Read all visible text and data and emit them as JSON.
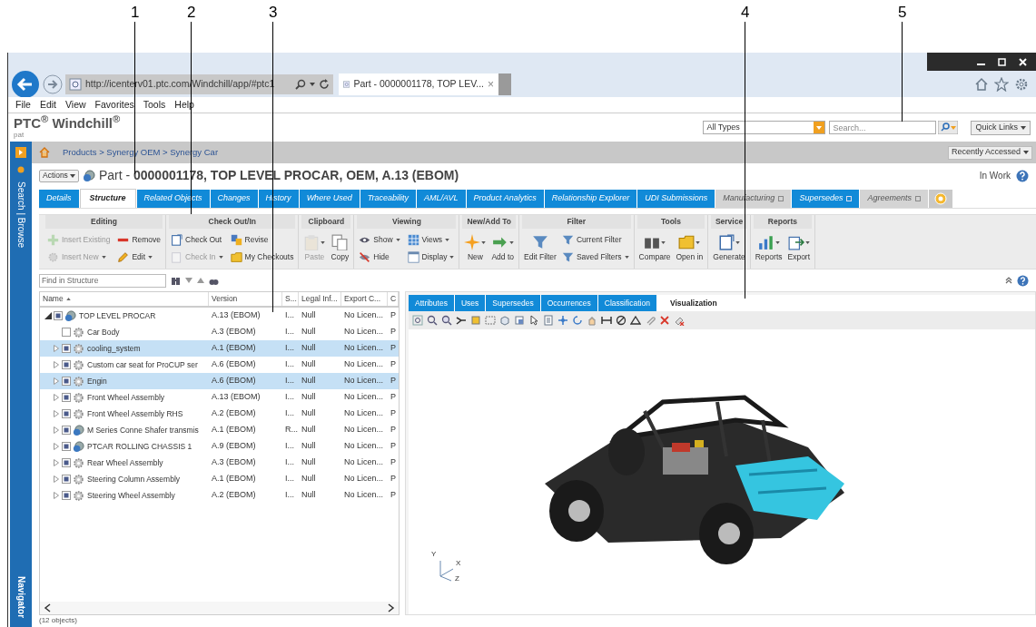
{
  "callouts": [
    {
      "label": "1"
    },
    {
      "label": "2"
    },
    {
      "label": "3"
    },
    {
      "label": "4"
    },
    {
      "label": "5"
    }
  ],
  "browser": {
    "address": "http://icenterv01.ptc.com/Windchill/app/#ptc1",
    "tab_title": "Part - 0000001178, TOP LEV...",
    "tab_close": "×"
  },
  "menu": [
    "File",
    "Edit",
    "View",
    "Favorites",
    "Tools",
    "Help"
  ],
  "header": {
    "brand": "PTC$^{®}$ Windchill$^{®}$",
    "user": "pat",
    "type_filter": "All Types",
    "search_placeholder": "Search...",
    "quick_links": "Quick Links"
  },
  "navigator": {
    "top_label": "Search | Browse",
    "bottom_label": "Navigator"
  },
  "breadcrumb": "Products > Synergy OEM > Synergy Car",
  "recently_accessed": "Recently Accessed",
  "page": {
    "actions": "Actions",
    "title": "Part - **0000001178, TOP LEVEL PROCAR, OEM, A.13 (EBOM)**",
    "state": "In Work"
  },
  "tabs": [
    {
      "label": "Details",
      "selected": false,
      "dimmed": false,
      "pinned": false
    },
    {
      "label": "Structure",
      "selected": true,
      "dimmed": false,
      "pinned": false
    },
    {
      "label": "Related Objects",
      "selected": false,
      "dimmed": false,
      "pinned": false
    },
    {
      "label": "Changes",
      "selected": false,
      "dimmed": false,
      "pinned": false
    },
    {
      "label": "History",
      "selected": false,
      "dimmed": false,
      "pinned": false
    },
    {
      "label": "Where Used",
      "selected": false,
      "dimmed": false,
      "pinned": false
    },
    {
      "label": "Traceability",
      "selected": false,
      "dimmed": false,
      "pinned": false
    },
    {
      "label": "AML/AVL",
      "selected": false,
      "dimmed": false,
      "pinned": false
    },
    {
      "label": "Product Analytics",
      "selected": false,
      "dimmed": false,
      "pinned": false
    },
    {
      "label": "Relationship Explorer",
      "selected": false,
      "dimmed": false,
      "pinned": false
    },
    {
      "label": "UDI Submissions",
      "selected": false,
      "dimmed": false,
      "pinned": false
    },
    {
      "label": "Manufacturing",
      "selected": false,
      "dimmed": true,
      "pinned": true
    },
    {
      "label": "Supersedes",
      "selected": false,
      "dimmed": false,
      "pinned": true
    },
    {
      "label": "Agreements",
      "selected": false,
      "dimmed": true,
      "pinned": true
    }
  ],
  "ribbon": [
    {
      "title": "Editing",
      "items": [
        {
          "label": "Insert Existing",
          "kind": "small",
          "disabled": true,
          "dropdown": false
        },
        {
          "label": "Insert New",
          "kind": "small",
          "disabled": true,
          "dropdown": true
        },
        {
          "label": "Remove",
          "kind": "small",
          "disabled": false,
          "dropdown": false
        },
        {
          "label": "Edit",
          "kind": "small",
          "disabled": false,
          "dropdown": true
        }
      ]
    },
    {
      "title": "Check Out/In",
      "items": [
        {
          "label": "Check Out",
          "kind": "small",
          "disabled": false,
          "dropdown": false
        },
        {
          "label": "Check In",
          "kind": "small",
          "disabled": true,
          "dropdown": true
        },
        {
          "label": "Revise",
          "kind": "small",
          "disabled": false,
          "dropdown": false
        },
        {
          "label": "My Checkouts",
          "kind": "small",
          "disabled": false,
          "dropdown": false
        }
      ]
    },
    {
      "title": "Clipboard",
      "items": [
        {
          "label": "Paste",
          "kind": "large",
          "disabled": true,
          "dropdown": true
        },
        {
          "label": "Copy",
          "kind": "large",
          "disabled": false,
          "dropdown": false
        }
      ]
    },
    {
      "title": "Viewing",
      "items": [
        {
          "label": "Show",
          "kind": "small",
          "disabled": false,
          "dropdown": true
        },
        {
          "label": "Hide",
          "kind": "small",
          "disabled": false,
          "dropdown": false
        },
        {
          "label": "Views",
          "kind": "small",
          "disabled": false,
          "dropdown": true
        },
        {
          "label": "Display",
          "kind": "small",
          "disabled": false,
          "dropdown": true
        }
      ]
    },
    {
      "title": "New/Add To",
      "items": [
        {
          "label": "New",
          "kind": "large",
          "disabled": false,
          "dropdown": true
        },
        {
          "label": "Add to",
          "kind": "large",
          "disabled": false,
          "dropdown": true
        }
      ]
    },
    {
      "title": "Filter",
      "items": [
        {
          "label": "Edit Filter",
          "kind": "large",
          "disabled": false,
          "dropdown": false
        },
        {
          "label": "Current Filter",
          "kind": "small",
          "disabled": false,
          "dropdown": false
        },
        {
          "label": "Saved Filters",
          "kind": "small",
          "disabled": false,
          "dropdown": true
        }
      ]
    },
    {
      "title": "Tools",
      "items": [
        {
          "label": "Compare",
          "kind": "large",
          "disabled": false,
          "dropdown": true
        },
        {
          "label": "Open in",
          "kind": "large",
          "disabled": false,
          "dropdown": true
        }
      ]
    },
    {
      "title": "Service",
      "items": [
        {
          "label": "Generate",
          "kind": "large",
          "disabled": false,
          "dropdown": true
        }
      ]
    },
    {
      "title": "Reports",
      "items": [
        {
          "label": "Reports",
          "kind": "large",
          "disabled": false,
          "dropdown": true
        },
        {
          "label": "Export",
          "kind": "large",
          "disabled": false,
          "dropdown": true
        }
      ]
    }
  ],
  "find": {
    "placeholder": "Find in Structure"
  },
  "table": {
    "columns": [
      "Name",
      "Version",
      "S...",
      "Legal Inf...",
      "Export C...",
      "C"
    ],
    "rows": [
      {
        "name": "TOP LEVEL PROCAR",
        "version": "A.13 (EBOM)",
        "s": "I...",
        "legal": "Null",
        "export": "No Licen...",
        "c": "P",
        "kind": "assembly",
        "leaf": false,
        "expanded": true,
        "checked": true,
        "selected": false,
        "children": [
          {
            "name": "Car Body",
            "version": "A.3 (EBOM)",
            "s": "I...",
            "legal": "Null",
            "export": "No Licen...",
            "c": "P",
            "kind": "part",
            "leaf": true,
            "expanded": false,
            "checked": false,
            "selected": false
          },
          {
            "name": "cooling_system",
            "version": "A.1 (EBOM)",
            "s": "I...",
            "legal": "Null",
            "export": "No Licen...",
            "c": "P",
            "kind": "part",
            "leaf": false,
            "expanded": false,
            "checked": true,
            "selected": true
          },
          {
            "name": "Custom car seat for ProCUP ser",
            "version": "A.6 (EBOM)",
            "s": "I...",
            "legal": "Null",
            "export": "No Licen...",
            "c": "P",
            "kind": "part",
            "leaf": false,
            "expanded": false,
            "checked": true,
            "selected": false
          },
          {
            "name": "Engin",
            "version": "A.6 (EBOM)",
            "s": "I...",
            "legal": "Null",
            "export": "No Licen...",
            "c": "P",
            "kind": "part",
            "leaf": false,
            "expanded": false,
            "checked": true,
            "selected": true
          },
          {
            "name": "Front Wheel Assembly",
            "version": "A.13 (EBOM)",
            "s": "I...",
            "legal": "Null",
            "export": "No Licen...",
            "c": "P",
            "kind": "part",
            "leaf": false,
            "expanded": false,
            "checked": true,
            "selected": false
          },
          {
            "name": "Front Wheel Assembly RHS",
            "version": "A.2 (EBOM)",
            "s": "I...",
            "legal": "Null",
            "export": "No Licen...",
            "c": "P",
            "kind": "part",
            "leaf": false,
            "expanded": false,
            "checked": true,
            "selected": false
          },
          {
            "name": "M Series Conne Shafer transmis",
            "version": "A.1 (EBOM)",
            "s": "R...",
            "legal": "Null",
            "export": "No Licen...",
            "c": "P",
            "kind": "assembly",
            "leaf": false,
            "expanded": false,
            "checked": true,
            "selected": false
          },
          {
            "name": "PTCAR ROLLING CHASSIS 1",
            "version": "A.9 (EBOM)",
            "s": "I...",
            "legal": "Null",
            "export": "No Licen...",
            "c": "P",
            "kind": "assembly",
            "leaf": false,
            "expanded": false,
            "checked": true,
            "selected": false
          },
          {
            "name": "Rear Wheel Assembly",
            "version": "A.3 (EBOM)",
            "s": "I...",
            "legal": "Null",
            "export": "No Licen...",
            "c": "P",
            "kind": "part",
            "leaf": false,
            "expanded": false,
            "checked": true,
            "selected": false
          },
          {
            "name": "Steering Column Assembly",
            "version": "A.1 (EBOM)",
            "s": "I...",
            "legal": "Null",
            "export": "No Licen...",
            "c": "P",
            "kind": "part",
            "leaf": false,
            "expanded": false,
            "checked": true,
            "selected": false
          },
          {
            "name": "Steering Wheel Assembly",
            "version": "A.2 (EBOM)",
            "s": "I...",
            "legal": "Null",
            "export": "No Licen...",
            "c": "P",
            "kind": "part",
            "leaf": false,
            "expanded": false,
            "checked": true,
            "selected": false
          }
        ]
      }
    ]
  },
  "status": "(12 objects)",
  "detail_tabs": [
    {
      "label": "Attributes",
      "selected": false
    },
    {
      "label": "Uses",
      "selected": false
    },
    {
      "label": "Supersedes",
      "selected": false
    },
    {
      "label": "Occurrences",
      "selected": false
    },
    {
      "label": "Classification",
      "selected": false
    },
    {
      "label": "Visualization",
      "selected": true
    }
  ],
  "viewport": {
    "axes": [
      "Y",
      "X",
      "Z"
    ]
  }
}
